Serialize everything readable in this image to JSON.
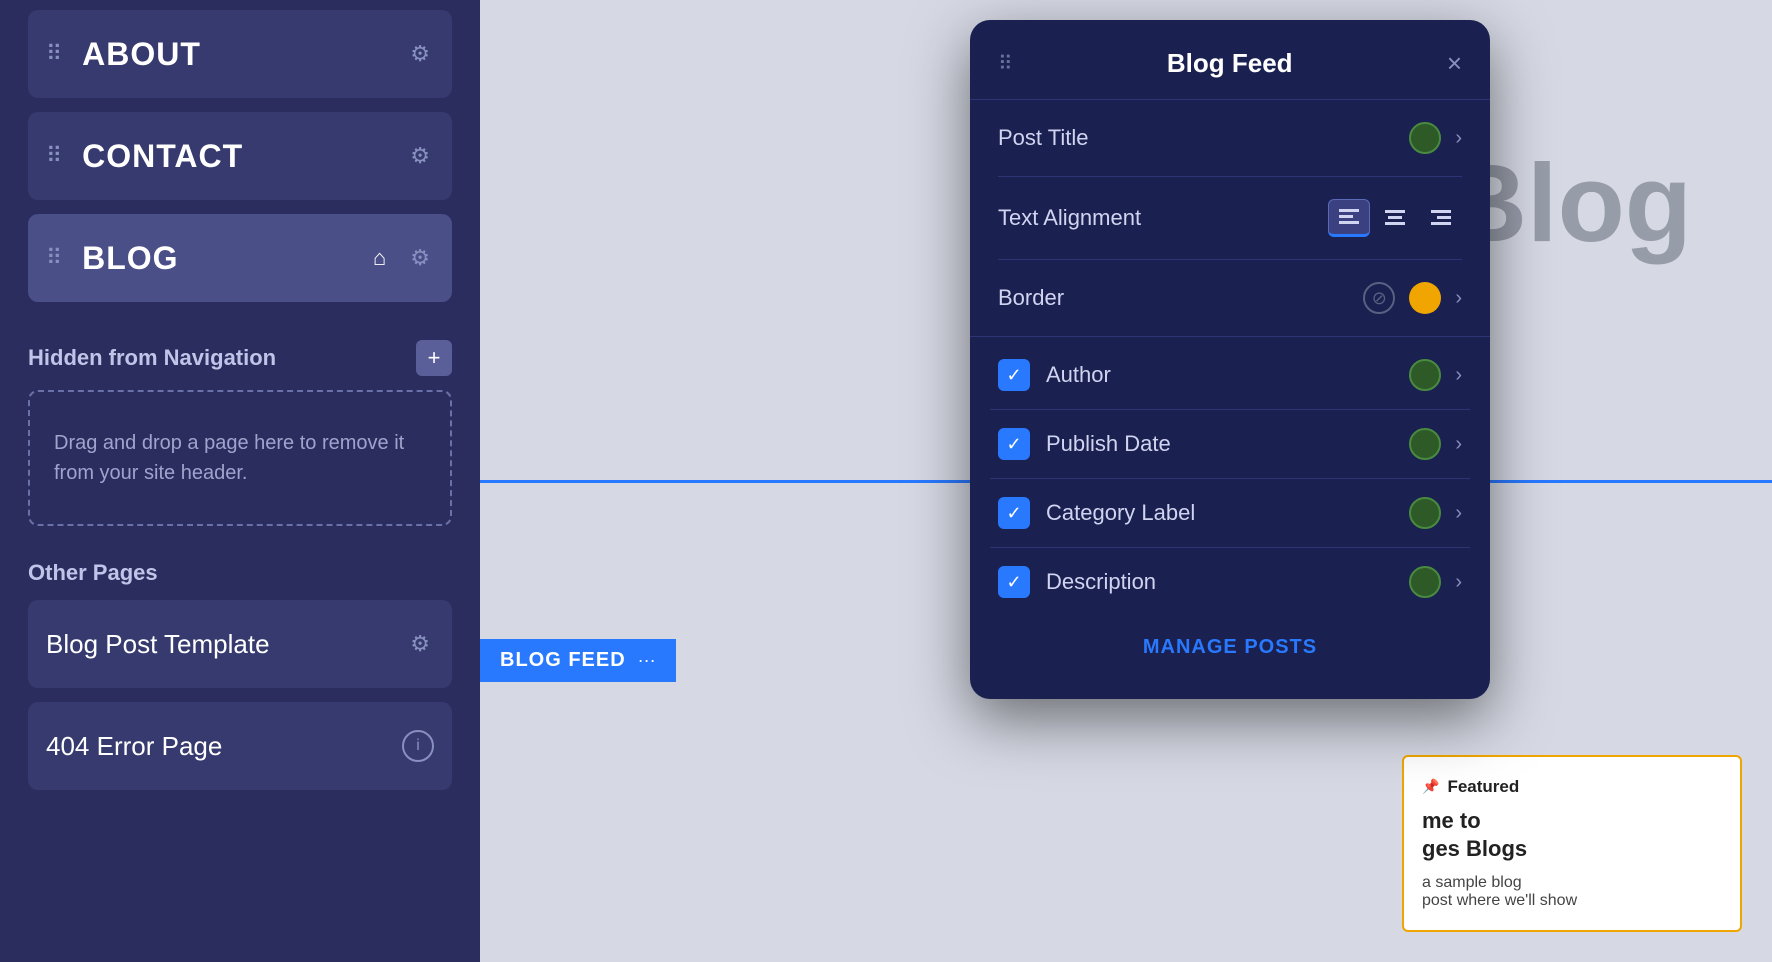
{
  "sidebar": {
    "nav_items": [
      {
        "id": "about",
        "label": "ABOUT",
        "active": false
      },
      {
        "id": "contact",
        "label": "CONTACT",
        "active": false
      },
      {
        "id": "blog",
        "label": "BLOG",
        "active": true,
        "has_home": true
      }
    ],
    "hidden_nav_section": "Hidden from Navigation",
    "drop_zone_text": "Drag and drop a page here to remove it from your site header.",
    "other_pages_section": "Other Pages",
    "other_pages": [
      {
        "id": "blog-post-template",
        "label": "Blog Post Template",
        "icon": "gear"
      },
      {
        "id": "404-error-page",
        "label": "404 Error Page",
        "icon": "info"
      }
    ]
  },
  "main": {
    "blog_feed_bar": {
      "label": "BLOG FEED",
      "dots_icon": "···"
    },
    "blog_heading": "Blog",
    "featured_card": {
      "label": "Featured",
      "heading": "me to\nges Blogs",
      "description": "a sample blog\npost where we'll show"
    }
  },
  "dialog": {
    "title": "Blog Feed",
    "drag_icon": "⠿",
    "close_icon": "×",
    "rows": [
      {
        "label": "Post Title",
        "type": "color-chevron",
        "color": "green"
      },
      {
        "label": "Text Alignment",
        "type": "align",
        "options": [
          "left",
          "center",
          "right"
        ],
        "active": 0
      },
      {
        "label": "Border",
        "type": "noentry-color-chevron",
        "color": "yellow"
      }
    ],
    "checkbox_rows": [
      {
        "label": "Author",
        "checked": true,
        "color": "green"
      },
      {
        "label": "Publish Date",
        "checked": true,
        "color": "green"
      },
      {
        "label": "Category Label",
        "checked": true,
        "color": "green"
      },
      {
        "label": "Description",
        "checked": true,
        "color": "green"
      }
    ],
    "manage_posts_label": "MANAGE POSTS",
    "colors": {
      "green": "#2d5a27",
      "yellow": "#f0a500"
    }
  }
}
